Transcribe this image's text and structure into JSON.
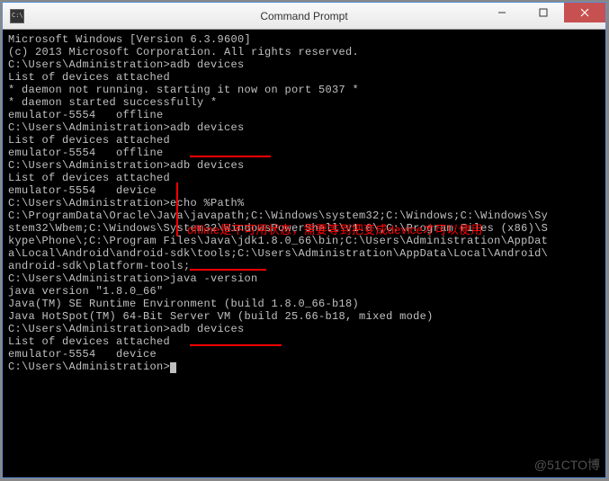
{
  "titlebar": {
    "title": "Command Prompt"
  },
  "lines": {
    "l0": "Microsoft Windows [Version 6.3.9600]",
    "l1": "(c) 2013 Microsoft Corporation. All rights reserved.",
    "l2": "",
    "l3": "C:\\Users\\Administration>adb devices",
    "l4": "List of devices attached",
    "l5": "* daemon not running. starting it now on port 5037 *",
    "l6": "* daemon started successfully *",
    "l7": "emulator-5554   offline",
    "l8": "",
    "l9": "C:\\Users\\Administration>adb devices",
    "l10": "List of devices attached",
    "l11": "emulator-5554   offline",
    "l12": "",
    "l13": "C:\\Users\\Administration>adb devices",
    "l14": "List of devices attached",
    "l15": "emulator-5554   device",
    "l16": "",
    "l17": "C:\\Users\\Administration>echo %Path%",
    "l18": "C:\\ProgramData\\Oracle\\Java\\javapath;C:\\Windows\\system32;C:\\Windows;C:\\Windows\\Sy",
    "l19": "stem32\\Wbem;C:\\Windows\\System32\\WindowsPowerShell\\v1.0\\;C:\\Program Files (x86)\\S",
    "l20": "kype\\Phone\\;C:\\Program Files\\Java\\jdk1.8.0_66\\bin;C:\\Users\\Administration\\AppDat",
    "l21": "a\\Local\\Android\\android-sdk\\tools;C:\\Users\\Administration\\AppData\\Local\\Android\\",
    "l22": "android-sdk\\platform-tools;",
    "l23": "",
    "l24": "C:\\Users\\Administration>java -version",
    "l25": "java version \"1.8.0_66\"",
    "l26": "Java(TM) SE Runtime Environment (build 1.8.0_66-b18)",
    "l27": "Java HotSpot(TM) 64-Bit Server VM (build 25.66-b18, mixed mode)",
    "l28": "",
    "l29": "C:\\Users\\Administration>adb devices",
    "l30": "List of devices attached",
    "l31": "emulator-5554   device",
    "l32": "",
    "l33": "C:\\Users\\Administration>"
  },
  "annotation": {
    "text": "offline是不可用状态，需要等到把变成device才可以使用"
  },
  "watermark": "@51CTO博"
}
